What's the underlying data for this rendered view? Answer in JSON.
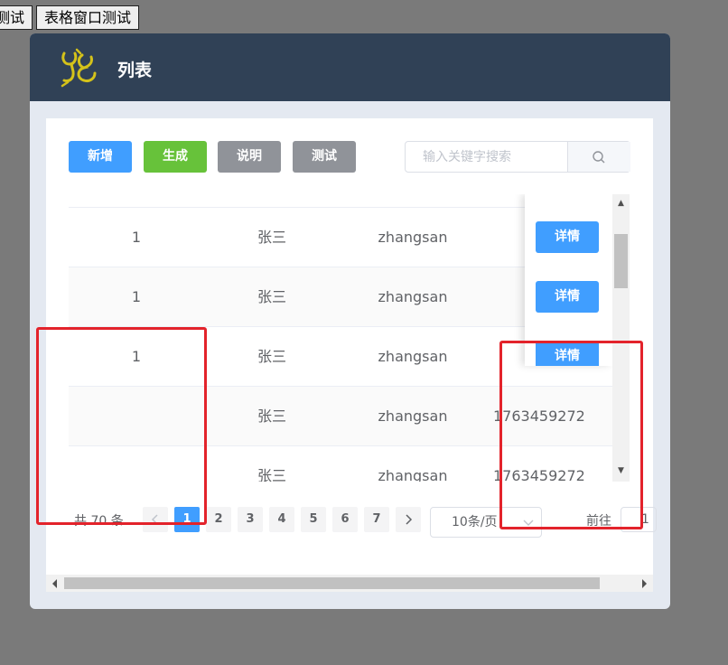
{
  "top_buttons": [
    "测试",
    "表格窗口测试"
  ],
  "dialog": {
    "title": "列表",
    "logo_color": "#d4c21a",
    "header_color": "#304156"
  },
  "toolbar": {
    "add": "新增",
    "generate": "生成",
    "explain": "说明",
    "test": "测试",
    "colors": {
      "primary": "#409eff",
      "success": "#67c23a",
      "info": "#909399"
    }
  },
  "search": {
    "placeholder": "输入关键字搜索",
    "icon": "search-icon"
  },
  "table": {
    "rows": [
      {
        "id": "1",
        "name": "张三",
        "account": "zhangsan",
        "phone": "",
        "action": "详情"
      },
      {
        "id": "1",
        "name": "张三",
        "account": "zhangsan",
        "phone": "",
        "action": "详情"
      },
      {
        "id": "1",
        "name": "张三",
        "account": "zhangsan",
        "phone": "",
        "action": "详情"
      },
      {
        "id": "",
        "name": "张三",
        "account": "zhangsan",
        "phone": "1763459272",
        "action": ""
      },
      {
        "id": "",
        "name": "张三",
        "account": "zhangsan",
        "phone": "1763459272",
        "action": ""
      }
    ]
  },
  "pagination": {
    "total": "共 70 条",
    "pages": [
      "1",
      "2",
      "3",
      "4",
      "5",
      "6",
      "7"
    ],
    "current_page": 1,
    "page_size": "10条/页",
    "goto_label": "前往",
    "goto_value": "1"
  },
  "annotation_color": "#e3232b"
}
